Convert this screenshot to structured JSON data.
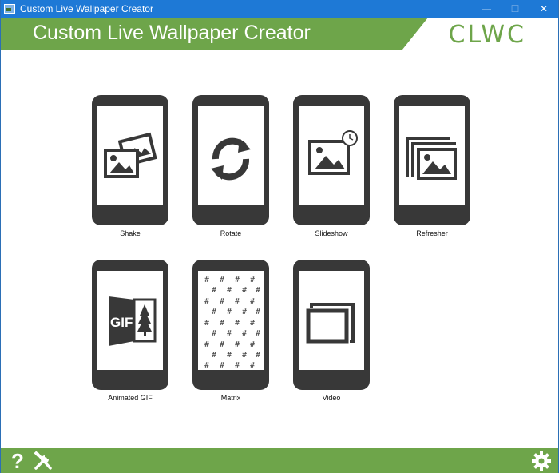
{
  "window": {
    "title": "Custom Live Wallpaper Creator",
    "controls": {
      "minimize": "—",
      "maximize": "☐",
      "close": "✕"
    }
  },
  "header": {
    "title": "Custom Live Wallpaper Creator",
    "logo": "CLWC",
    "accent_color": "#6ea54a"
  },
  "tiles": [
    {
      "label": "Shake",
      "icon": "shake-photos-icon"
    },
    {
      "label": "Rotate",
      "icon": "rotate-arrows-icon"
    },
    {
      "label": "Slideshow",
      "icon": "slideshow-clock-icon"
    },
    {
      "label": "Refresher",
      "icon": "refresher-stacked-photos-icon"
    },
    {
      "label": "Animated GIF",
      "icon": "gif-door-icon"
    },
    {
      "label": "Matrix",
      "icon": "matrix-hash-icon"
    },
    {
      "label": "Video",
      "icon": "video-frame-icon"
    }
  ],
  "footer": {
    "help": "?",
    "tools_icon": "tools-icon",
    "settings_icon": "gear-icon"
  }
}
